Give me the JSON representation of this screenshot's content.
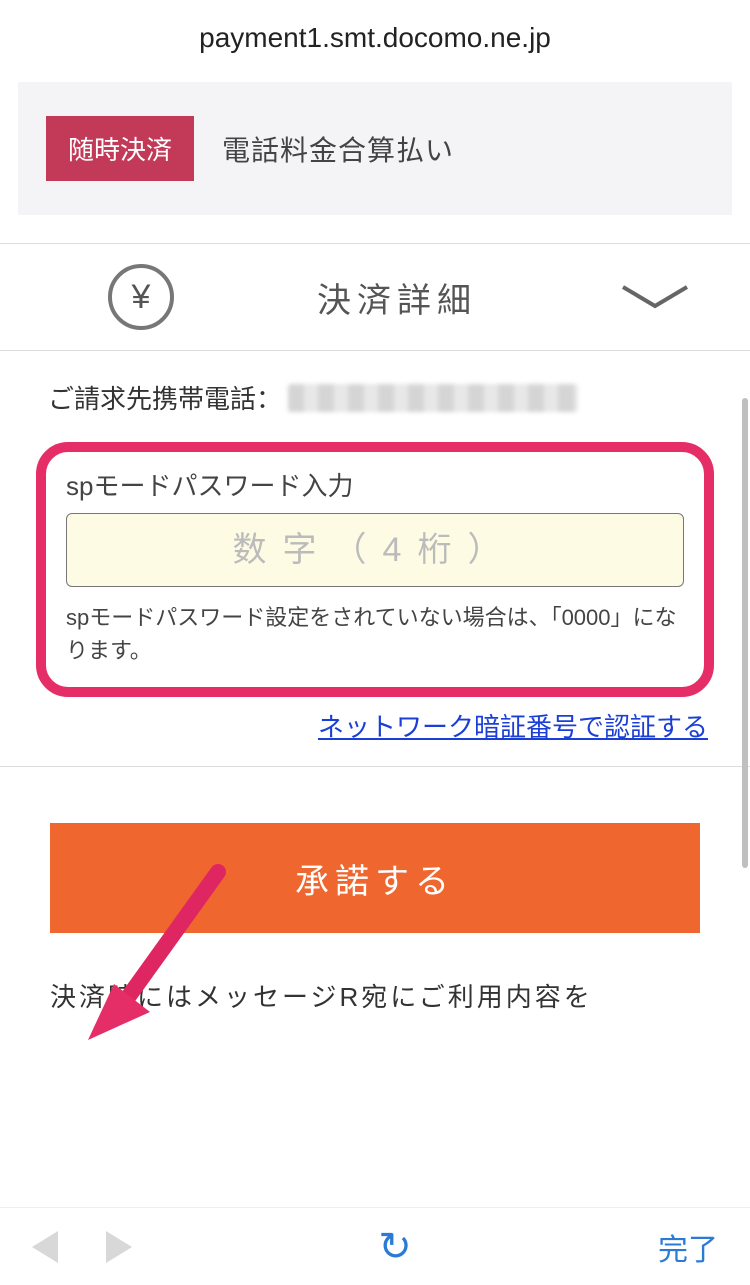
{
  "url": "payment1.smt.docomo.ne.jp",
  "payment_method": {
    "badge": "随時決済",
    "text": "電話料金合算払い"
  },
  "details": {
    "title": "決済詳細",
    "yen_symbol": "¥"
  },
  "billing": {
    "label": "ご請求先携帯電話："
  },
  "password_section": {
    "label": "spモードパスワード入力",
    "placeholder": "数字（4桁）",
    "help": "spモードパスワード設定をされていない場合は、「0000」になります。"
  },
  "auth_link": "ネットワーク暗証番号で認証する",
  "accept_button": "承諾する",
  "note": "決済時にはメッセージR宛にご利用内容を",
  "bottom_bar": {
    "done": "完了"
  },
  "annotation": {
    "highlight_color": "#e52e68"
  }
}
